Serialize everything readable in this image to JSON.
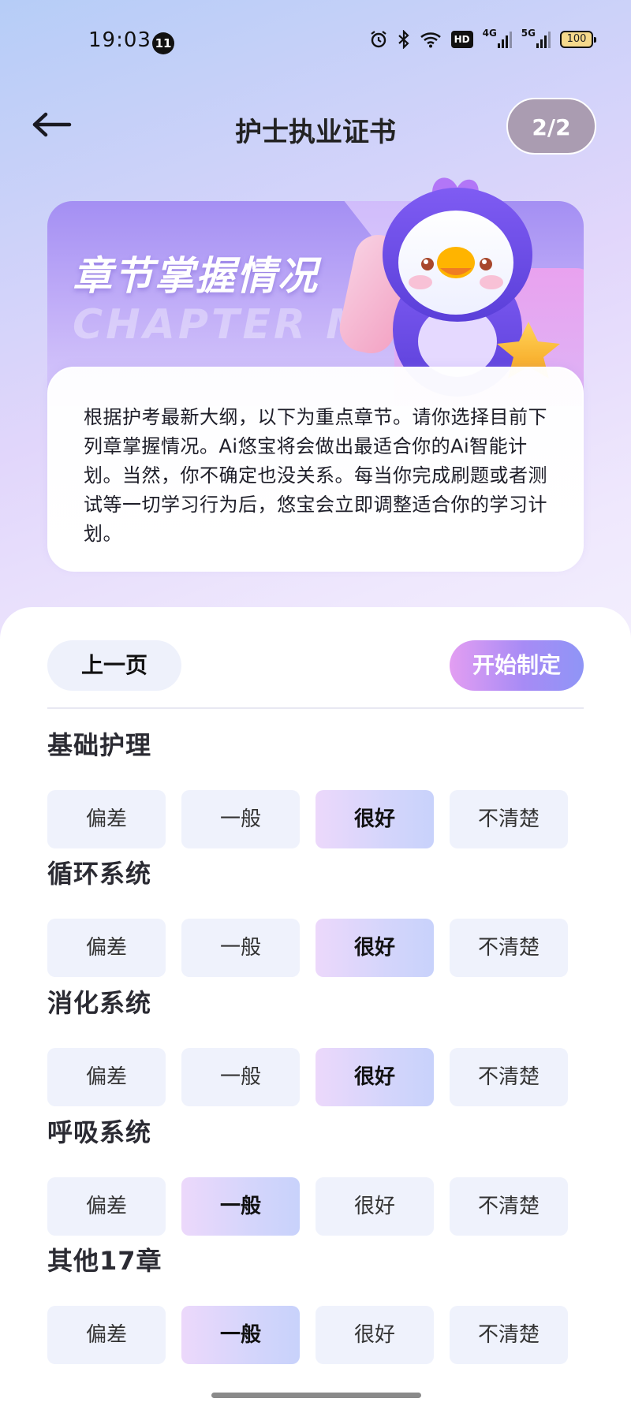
{
  "status_bar": {
    "time": "19:03",
    "notification_count": "11",
    "network_hd": "HD",
    "signal_1": "4G",
    "signal_2": "5G",
    "battery": "100"
  },
  "header": {
    "title": "护士执业证书",
    "page_indicator": "2/2"
  },
  "hero": {
    "title": "章节掌握情况",
    "watermark": "CHAPTER MA",
    "description": "根据护考最新大纲，以下为重点章节。请你选择目前下列章掌握情况。Ai悠宝将会做出最适合你的Ai智能计划。当然，你不确定也没关系。每当你完成刷题或者测试等一切学习行为后，悠宝会立即调整适合你的学习计划。"
  },
  "actions": {
    "prev_label": "上一页",
    "start_label": "开始制定"
  },
  "option_labels": [
    "偏差",
    "一般",
    "很好",
    "不清楚"
  ],
  "chapters": [
    {
      "name": "基础护理",
      "selected": "很好"
    },
    {
      "name": "循环系统",
      "selected": "很好"
    },
    {
      "name": "消化系统",
      "selected": "很好"
    },
    {
      "name": "呼吸系统",
      "selected": "一般"
    },
    {
      "name": "其他17章",
      "selected": "一般"
    }
  ],
  "colors": {
    "accent_gradient_start": "#e39ef2",
    "accent_gradient_end": "#8f95f6",
    "option_bg": "#eff2fc",
    "page_indicator_bg": "#aa9cb1"
  }
}
